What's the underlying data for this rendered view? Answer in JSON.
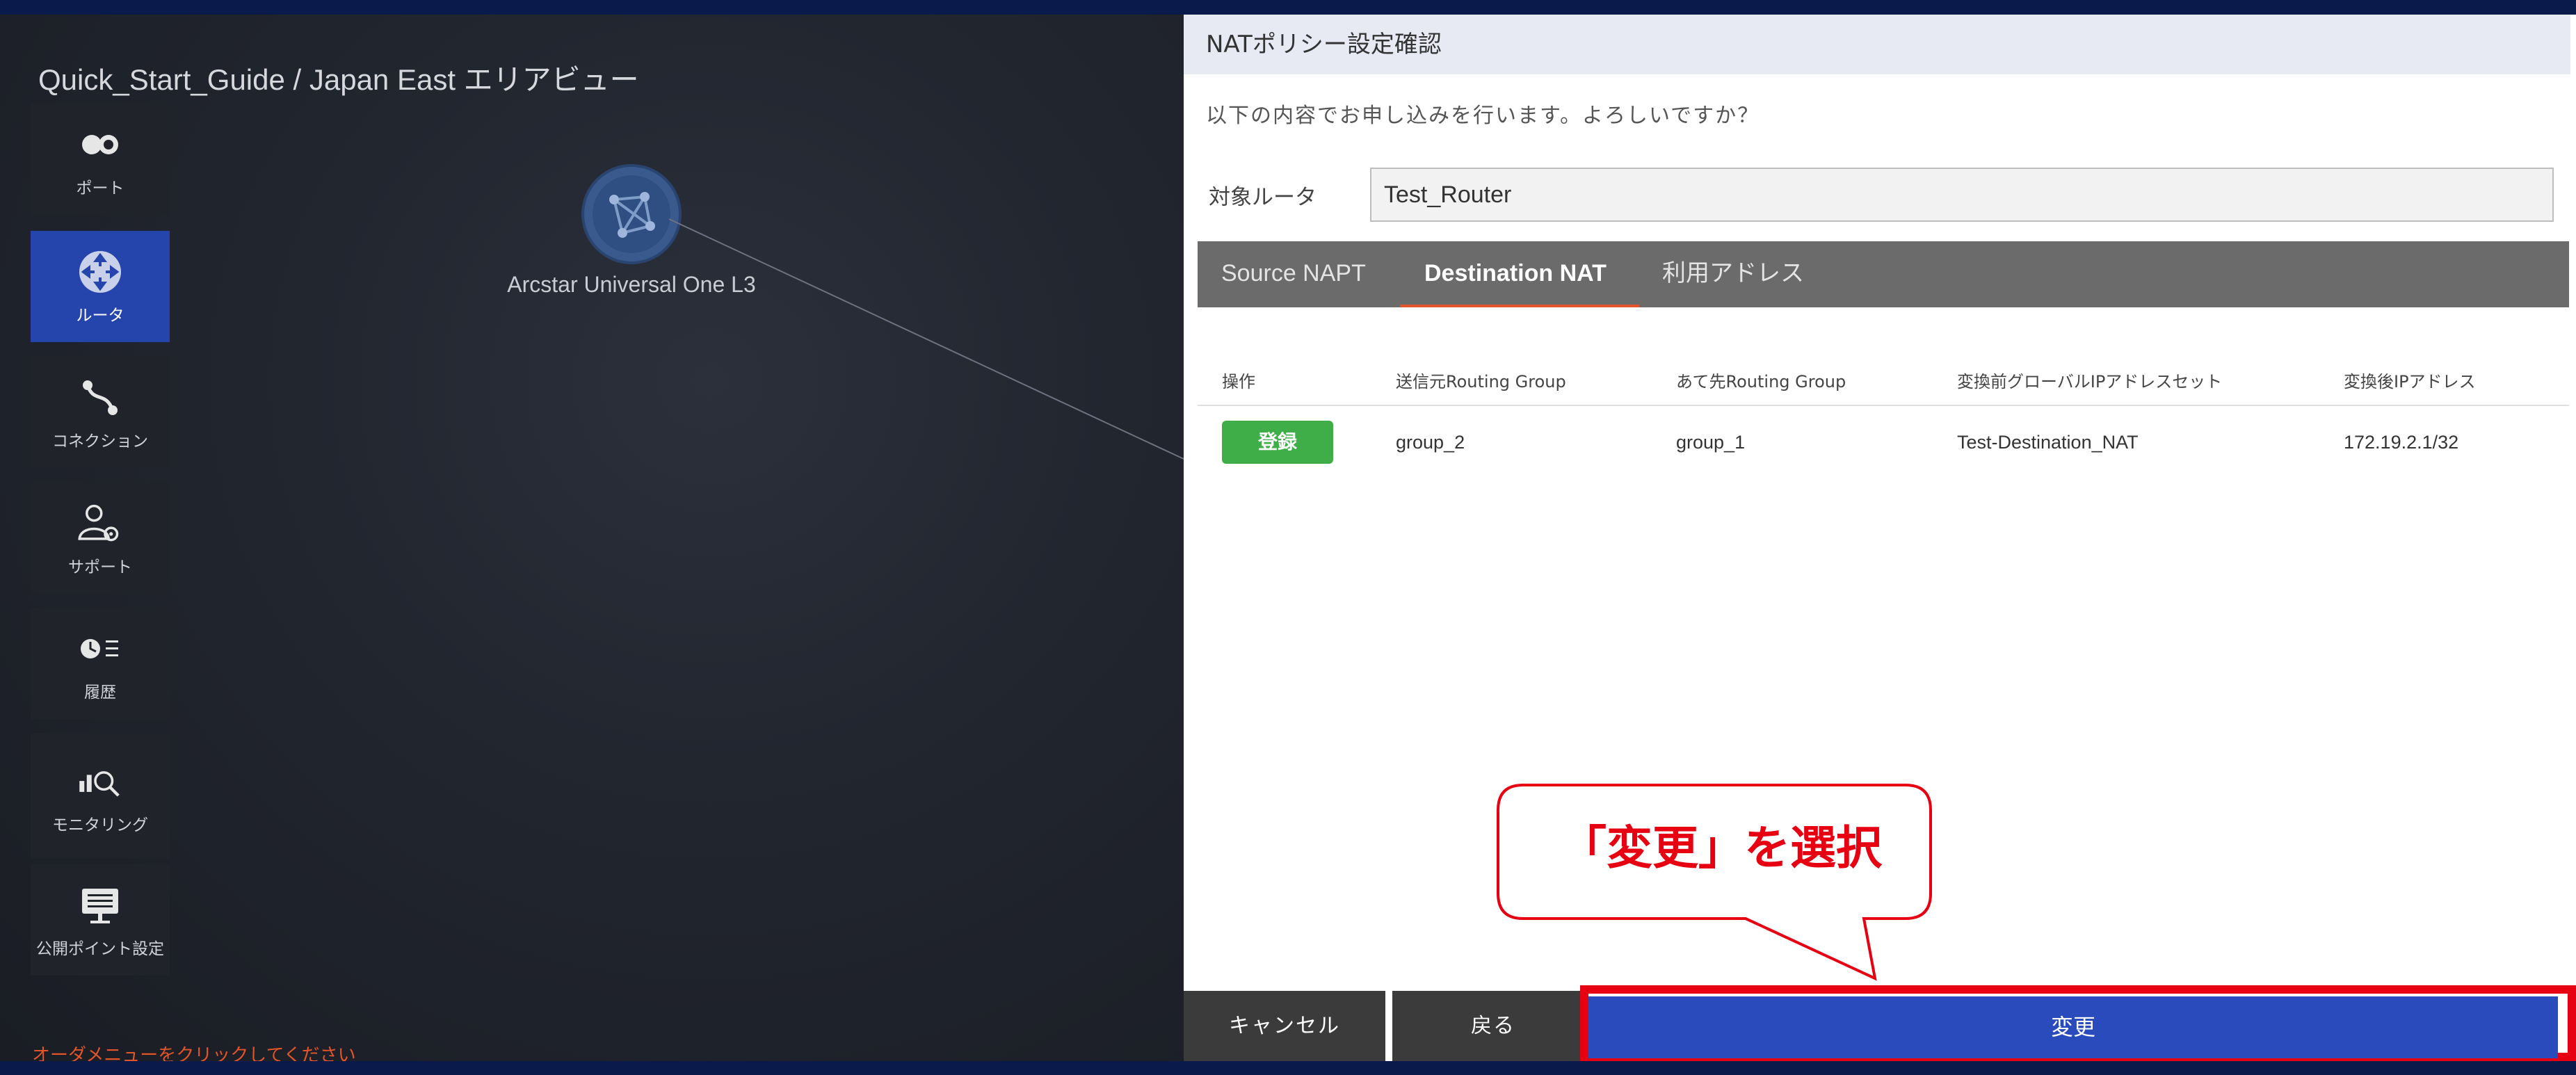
{
  "colors": {
    "accent_blue": "#2a4bbb",
    "sidebar_active": "#2545ad",
    "badge_green": "#3fae49",
    "tab_underline": "#e2552a",
    "hint_orange": "#e2552a",
    "callout_red": "#e60012"
  },
  "page": {
    "title": "Quick_Start_Guide / Japan East エリアビュー",
    "order_hint": "オーダメニューをクリックしてください"
  },
  "sidebar": {
    "items": [
      {
        "label": "ポート",
        "icon": "port-icon",
        "active": false
      },
      {
        "label": "ルータ",
        "icon": "router-icon",
        "active": true
      },
      {
        "label": "コネクション",
        "icon": "connection-icon",
        "active": false
      },
      {
        "label": "サポート",
        "icon": "support-icon",
        "active": false
      },
      {
        "label": "履歴",
        "icon": "history-icon",
        "active": false
      },
      {
        "label": "モニタリング",
        "icon": "monitoring-icon",
        "active": false
      },
      {
        "label": "公開ポイント設定",
        "icon": "public-point-icon",
        "active": false
      }
    ]
  },
  "canvas": {
    "node_label": "Arcstar Universal One L3",
    "node_icon": "network-globe-icon"
  },
  "dialog": {
    "title": "NATポリシー設定確認",
    "confirm_message": "以下の内容でお申し込みを行います。よろしいですか？",
    "router_label": "対象ルータ",
    "router_value": "Test_Router",
    "tabs": [
      {
        "label": "Source NAPT",
        "active": false
      },
      {
        "label": "Destination NAT",
        "active": true
      },
      {
        "label": "利用アドレス",
        "active": false
      }
    ],
    "table": {
      "headers": [
        "操作",
        "送信元Routing Group",
        "あて先Routing Group",
        "変換前グローバルIPアドレスセット",
        "変換後IPアドレス"
      ],
      "rows": [
        {
          "op": "登録",
          "src_group": "group_2",
          "dst_group": "group_1",
          "ip_set": "Test-Destination_NAT",
          "ip_after": "172.19.2.1/32"
        }
      ]
    },
    "buttons": {
      "cancel": "キャンセル",
      "back": "戻る",
      "change": "変更"
    }
  },
  "callout": {
    "text": "「変更」を選択"
  }
}
